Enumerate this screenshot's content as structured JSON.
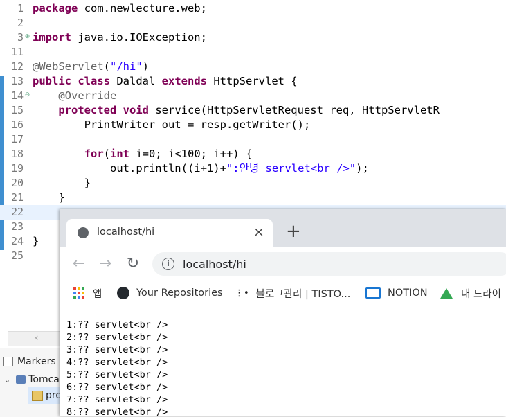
{
  "editor": {
    "lines": [
      {
        "n": "1",
        "tokens": [
          {
            "t": "package",
            "c": "kw"
          },
          {
            "t": " com.newlecture.web;",
            "c": ""
          }
        ]
      },
      {
        "n": "2",
        "tokens": []
      },
      {
        "n": "3",
        "tokens": [
          {
            "t": "import",
            "c": "kw"
          },
          {
            "t": " java.io.IOException;",
            "c": ""
          }
        ],
        "fold": "+"
      },
      {
        "n": "11",
        "tokens": []
      },
      {
        "n": "12",
        "tokens": [
          {
            "t": "@WebServlet",
            "c": "ann"
          },
          {
            "t": "(",
            "c": ""
          },
          {
            "t": "\"/hi\"",
            "c": "str"
          },
          {
            "t": ")",
            "c": ""
          }
        ]
      },
      {
        "n": "13",
        "tokens": [
          {
            "t": "public",
            "c": "kw"
          },
          {
            "t": " ",
            "c": ""
          },
          {
            "t": "class",
            "c": "kw"
          },
          {
            "t": " Daldal ",
            "c": ""
          },
          {
            "t": "extends",
            "c": "kw"
          },
          {
            "t": " HttpServlet {",
            "c": ""
          }
        ]
      },
      {
        "n": "14",
        "tokens": [
          {
            "t": "    @Override",
            "c": "ann"
          }
        ],
        "fold": "-"
      },
      {
        "n": "15",
        "tokens": [
          {
            "t": "    ",
            "c": ""
          },
          {
            "t": "protected",
            "c": "kw"
          },
          {
            "t": " ",
            "c": ""
          },
          {
            "t": "void",
            "c": "kw"
          },
          {
            "t": " service(HttpServletRequest ",
            "c": ""
          },
          {
            "t": "req",
            "c": ""
          },
          {
            "t": ", HttpServletR",
            "c": ""
          }
        ]
      },
      {
        "n": "16",
        "tokens": [
          {
            "t": "        PrintWriter ",
            "c": ""
          },
          {
            "t": "out",
            "c": ""
          },
          {
            "t": " = ",
            "c": ""
          },
          {
            "t": "resp",
            "c": ""
          },
          {
            "t": ".getWriter();",
            "c": ""
          }
        ]
      },
      {
        "n": "17",
        "tokens": []
      },
      {
        "n": "18",
        "tokens": [
          {
            "t": "        ",
            "c": ""
          },
          {
            "t": "for",
            "c": "kw"
          },
          {
            "t": "(",
            "c": ""
          },
          {
            "t": "int",
            "c": "kw"
          },
          {
            "t": " i=0; i<100; i++) {",
            "c": ""
          }
        ]
      },
      {
        "n": "19",
        "tokens": [
          {
            "t": "            ",
            "c": ""
          },
          {
            "t": "out",
            "c": ""
          },
          {
            "t": ".println((i+1)+",
            "c": ""
          },
          {
            "t": "\":안녕 servlet<br />\"",
            "c": "str"
          },
          {
            "t": ");",
            "c": ""
          }
        ]
      },
      {
        "n": "20",
        "tokens": [
          {
            "t": "        }",
            "c": ""
          }
        ]
      },
      {
        "n": "21",
        "tokens": [
          {
            "t": "    }",
            "c": ""
          }
        ]
      },
      {
        "n": "22",
        "tokens": []
      },
      {
        "n": "23",
        "tokens": []
      },
      {
        "n": "24",
        "tokens": [
          {
            "t": "}",
            "c": ""
          }
        ]
      },
      {
        "n": "25",
        "tokens": []
      }
    ]
  },
  "panel": {
    "markers_label": "Markers",
    "tree_server": "Tomca",
    "tree_child": "pro"
  },
  "browser": {
    "tab_title": "localhost/hi",
    "url": "localhost/hi",
    "bookmarks": [
      {
        "label": "앱",
        "icon": "apps-grid-icon"
      },
      {
        "label": "Your Repositories",
        "icon": "github-icon"
      },
      {
        "label": "블로그관리 | TISTO...",
        "icon": "tistory-icon"
      },
      {
        "label": "NOTION",
        "icon": "notion-icon"
      },
      {
        "label": "내 드라이",
        "icon": "google-drive-icon"
      }
    ],
    "output_lines": [
      "1:?? servlet<br />",
      "2:?? servlet<br />",
      "3:?? servlet<br />",
      "4:?? servlet<br />",
      "5:?? servlet<br />",
      "6:?? servlet<br />",
      "7:?? servlet<br />",
      "8:?? servlet<br />"
    ]
  }
}
